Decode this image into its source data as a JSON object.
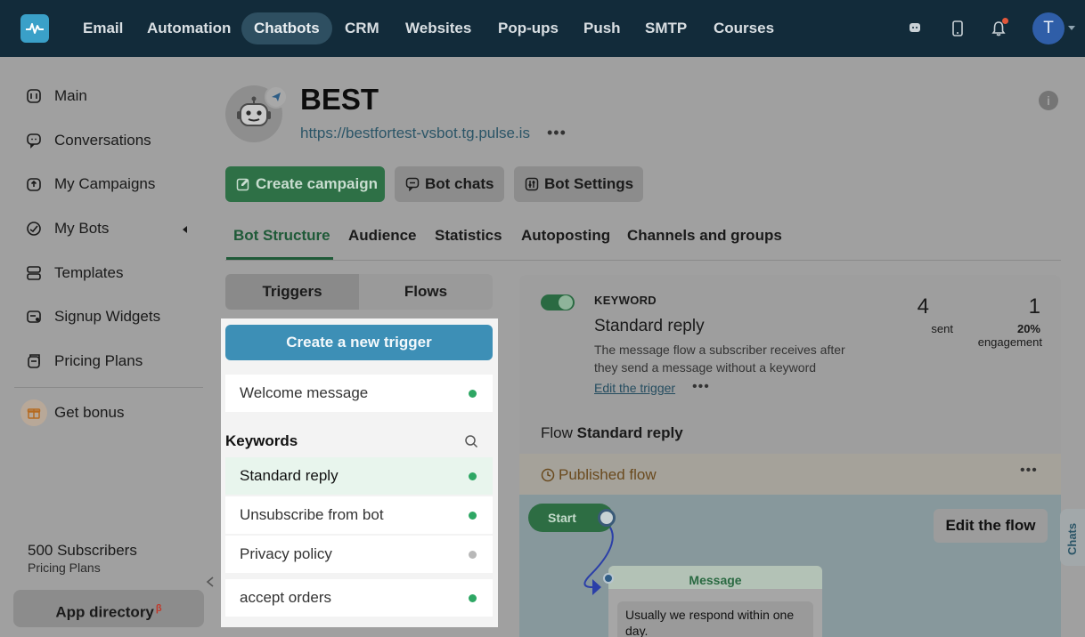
{
  "colors": {
    "topbar": "#122b3a",
    "active_tab": "#1f5a38",
    "primary_green": "#2e7046",
    "trigger_blue": "#3d8fb6",
    "status_dot_active": "#2ea764",
    "status_dot_inactive": "#b8b8b8",
    "published": "#6a4a1e"
  },
  "topnav": {
    "items": [
      {
        "label": "Email"
      },
      {
        "label": "Automation"
      },
      {
        "label": "Chatbots",
        "active": true
      },
      {
        "label": "CRM"
      },
      {
        "label": "Websites"
      },
      {
        "label": "Pop-ups"
      },
      {
        "label": "Push"
      },
      {
        "label": "SMTP"
      },
      {
        "label": "Courses"
      }
    ],
    "avatar_initial": "T"
  },
  "sidebar": {
    "items": [
      {
        "label": "Main",
        "icon": "dashboard-icon"
      },
      {
        "label": "Conversations",
        "icon": "chat-bubble-icon"
      },
      {
        "label": "My Campaigns",
        "icon": "campaign-icon"
      },
      {
        "label": "My Bots",
        "icon": "bot-icon"
      },
      {
        "label": "Templates",
        "icon": "templates-icon"
      },
      {
        "label": "Signup Widgets",
        "icon": "widget-icon"
      },
      {
        "label": "Pricing Plans",
        "icon": "pricing-icon"
      }
    ],
    "bonus_label": "Get bonus",
    "subscribers": "500 Subscribers",
    "plan_link": "Pricing Plans",
    "app_directory": "App directory",
    "app_directory_badge": "β"
  },
  "bot": {
    "name": "BEST",
    "url": "https://bestfortest-vsbot.tg.pulse.is",
    "more": "•••"
  },
  "actions": {
    "create_campaign": "Create campaign",
    "bot_chats": "Bot chats",
    "bot_settings": "Bot Settings"
  },
  "tabs": [
    {
      "label": "Bot Structure",
      "active": true
    },
    {
      "label": "Audience"
    },
    {
      "label": "Statistics"
    },
    {
      "label": "Autoposting"
    },
    {
      "label": "Channels and groups"
    }
  ],
  "segmented": {
    "triggers": "Triggers",
    "flows": "Flows"
  },
  "triggers_panel": {
    "create_button": "Create a new trigger",
    "welcome": "Welcome message",
    "keywords_header": "Keywords",
    "items": [
      {
        "label": "Standard reply",
        "active": true,
        "selected": true
      },
      {
        "label": "Unsubscribe from bot",
        "active": true
      },
      {
        "label": "Privacy policy",
        "active": false
      },
      {
        "label": "accept orders",
        "active": true
      }
    ]
  },
  "trigger_detail": {
    "type_label": "KEYWORD",
    "title": "Standard reply",
    "description": "The message flow a subscriber receives after they send a message without a keyword",
    "edit_link": "Edit the trigger",
    "more": "•••",
    "stats": {
      "sent_value": "4",
      "sent_label": "sent",
      "engagement_value": "1",
      "engagement_pct": "20%",
      "engagement_label": "engagement"
    },
    "flow_prefix": "Flow",
    "flow_name": "Standard reply",
    "published_label": "Published flow",
    "published_more": "•••"
  },
  "flow_canvas": {
    "start_label": "Start",
    "edit_flow": "Edit the flow",
    "message_title": "Message",
    "message_text": "Usually we respond within one day."
  },
  "chats_tab": "Chats"
}
